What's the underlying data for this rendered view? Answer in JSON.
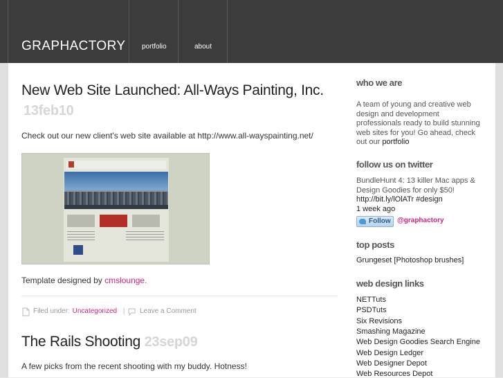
{
  "header": {
    "logo": "GRAPHACTORY",
    "nav": [
      {
        "label": "portfolio"
      },
      {
        "label": "about"
      }
    ]
  },
  "posts": [
    {
      "title": "New Web Site Launched: All-Ways Painting, Inc.",
      "date": "13feb10",
      "body": "Check out our new client's web site available at http://www.all-wayspainting.net/",
      "credit_prefix": "Template designed by ",
      "credit_link": "cmslounge",
      "credit_suffix": ".",
      "meta": {
        "filed_under": "Filed under:",
        "category": "Uncategorized",
        "separator": "|",
        "comment_link": "Leave a Comment"
      }
    },
    {
      "title": "The Rails Shooting",
      "date": "23sep09",
      "body": "A few picks from the recent shooting with my buddy. Hotness!"
    }
  ],
  "sidebar": {
    "who": {
      "heading": "who we are",
      "lines": [
        "A team of young and creative web",
        "design and development",
        "professionals ready to build stunning",
        "web sites for you! Go ahead, check"
      ],
      "last_prefix": "out our ",
      "last_link": "portfolio"
    },
    "twitter": {
      "heading": "follow us on twitter",
      "tweet_lines": [
        "BundleHunt 4: 13 killer Mac apps &",
        "Design Goodies for only $50!",
        "http://bit.ly/lOlATr #design"
      ],
      "time": "1 week ago",
      "follow_label": "Follow",
      "handle": "@graphactory"
    },
    "top_posts": {
      "heading": "top posts",
      "items": [
        "Grungeset [Photoshop brushes]"
      ]
    },
    "links": {
      "heading": "web design links",
      "items": [
        "NETTuts",
        "PSDTuts",
        "Six Revisions",
        "Smashing Magazine",
        "Web Design Goodies Search Engine",
        "Web Design Ledger",
        "Web Designer Depot",
        "Web Resources Depot"
      ]
    }
  },
  "colors": {
    "header_bg": "#3c3c3c",
    "accent_link": "#d4237a",
    "date_text": "#d6d6d6"
  }
}
